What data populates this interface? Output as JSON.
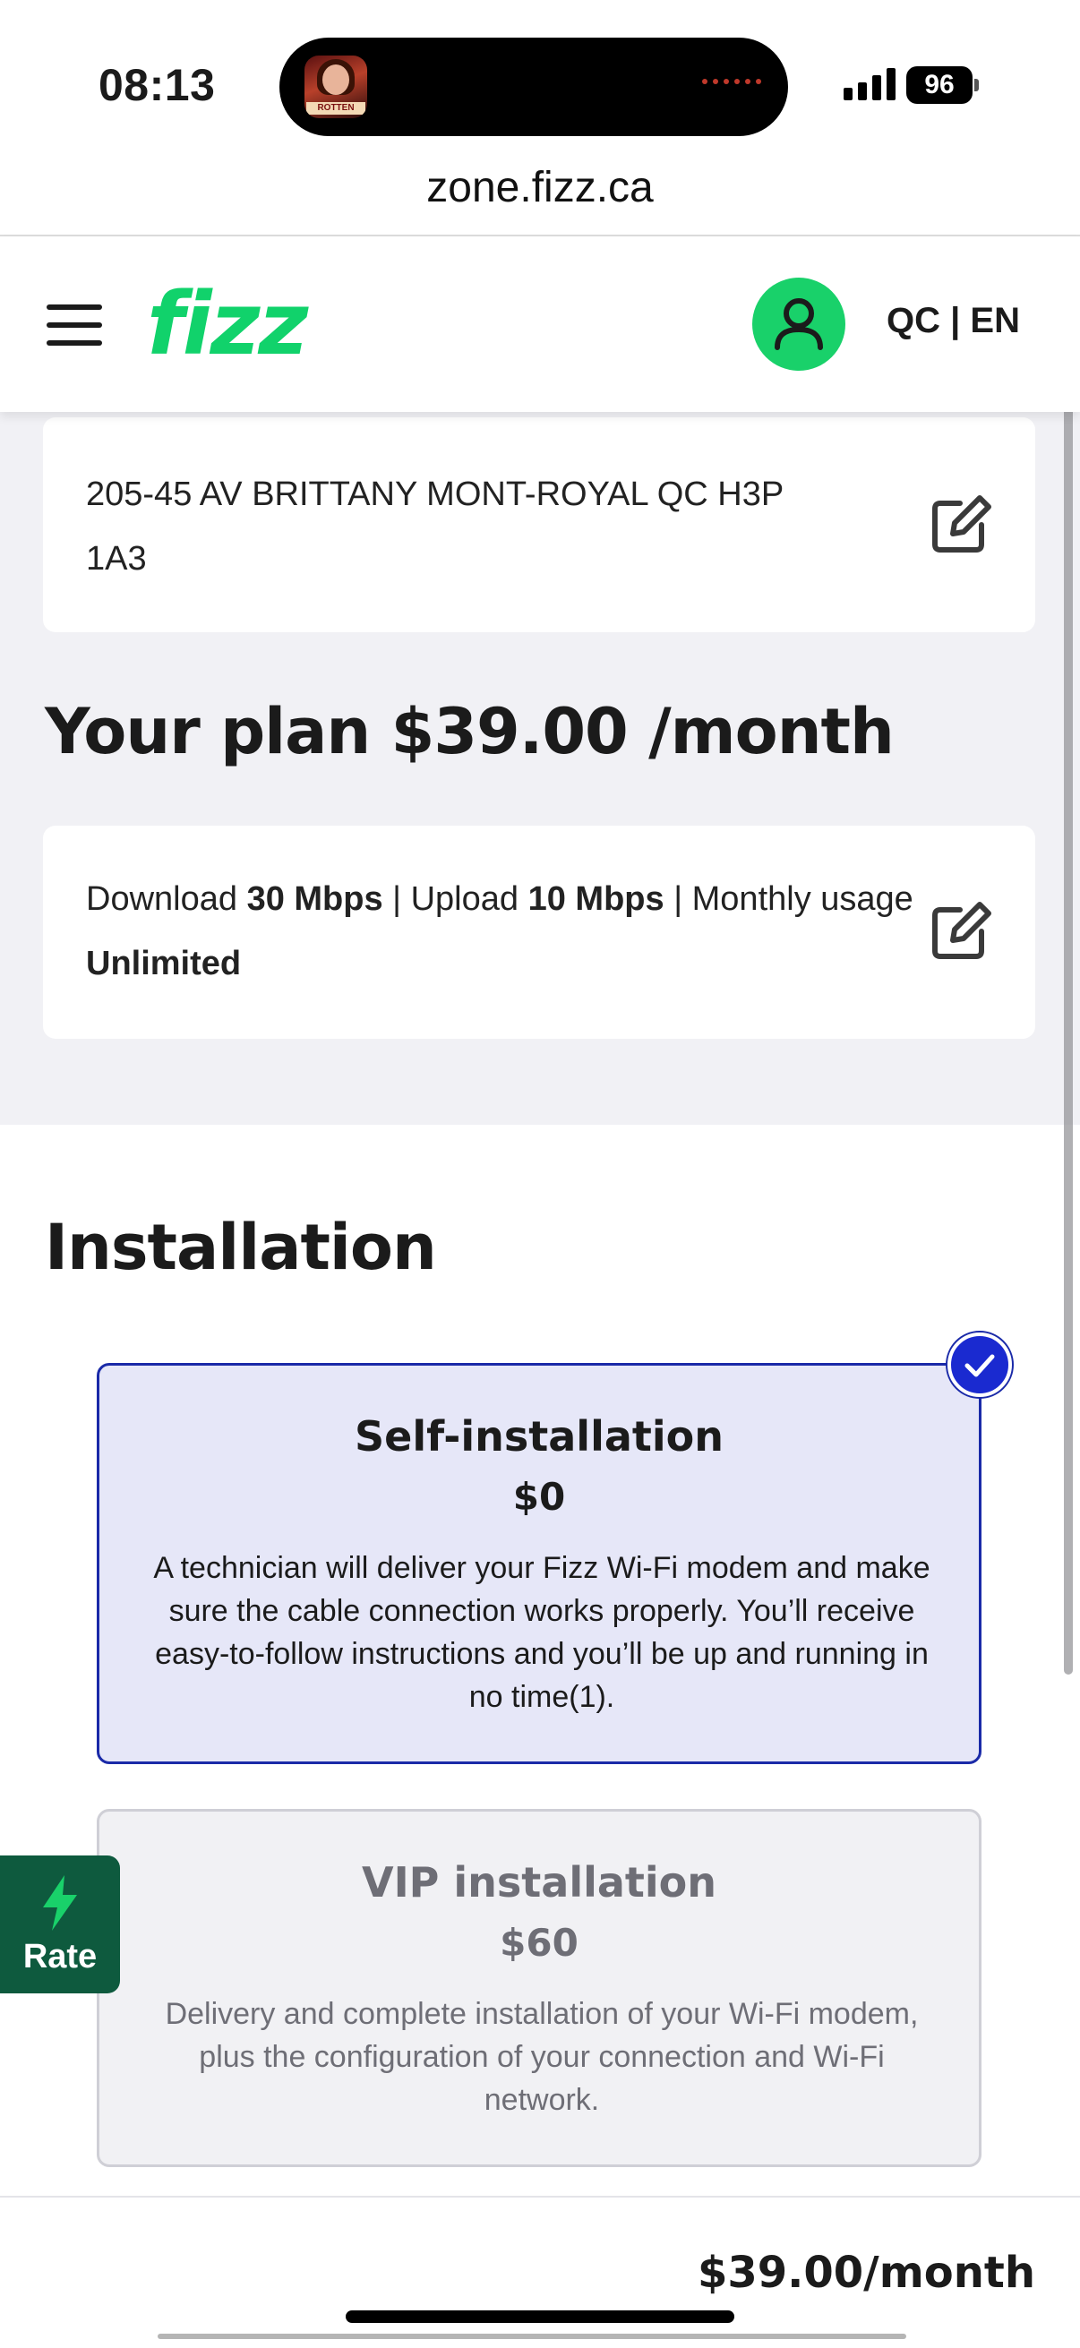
{
  "status_bar": {
    "time": "08:13",
    "battery": "96",
    "now_playing_thumb_label": "ROTTEN"
  },
  "browser": {
    "url": "zone.fizz.ca"
  },
  "header": {
    "logo": "fizz",
    "language": "QC | EN",
    "brand_color": "#11d26b"
  },
  "address": {
    "line1": "205-45 AV BRITTANY MONT-ROYAL QC H3P",
    "line2": "1A3"
  },
  "plan": {
    "title": "Your plan $39.00 /month",
    "download_label": "Download",
    "download_value": "30 Mbps",
    "sep1": " | ",
    "upload_label": "Upload",
    "upload_value": "10 Mbps",
    "sep2": " | ",
    "usage_label": "Monthly usage",
    "usage_value": "Unlimited"
  },
  "installation": {
    "title": "Installation",
    "options": [
      {
        "name": "Self-installation",
        "price": "$0",
        "description": "A technician will deliver your Fizz Wi-Fi modem and make sure the cable connection works properly. You’ll receive easy-to-follow instructions and you’ll be up and running in no time(1).",
        "selected": true
      },
      {
        "name": "VIP installation",
        "price": "$60",
        "description": "Delivery and complete installation of your Wi-Fi modem, plus the configuration of your connection and Wi-Fi network.",
        "selected": false
      }
    ]
  },
  "rate_tab": {
    "label": "Rate"
  },
  "footer": {
    "total": "$39.00/month"
  }
}
